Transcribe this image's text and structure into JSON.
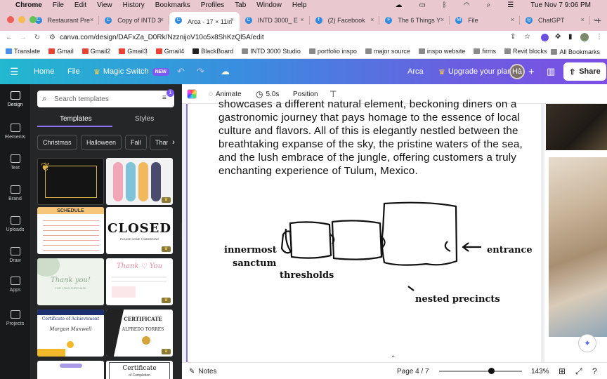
{
  "menubar": {
    "app": "Chrome",
    "items": [
      "File",
      "Edit",
      "View",
      "History",
      "Bookmarks",
      "Profiles",
      "Tab",
      "Window",
      "Help"
    ],
    "datetime": "Tue Nov 7  9:06 PM"
  },
  "tabs": [
    {
      "title": "Restaurant Pre",
      "fav": "C",
      "active": false
    },
    {
      "title": "Copy of INTD 3",
      "fav": "C",
      "active": false
    },
    {
      "title": "Arca - 17 × 11in",
      "fav": "C",
      "active": true
    },
    {
      "title": "INTD 3000_ E",
      "fav": "C",
      "active": false
    },
    {
      "title": "(2) Facebook",
      "fav": "f",
      "active": false
    },
    {
      "title": "The 6 Things Y",
      "fav": "F",
      "active": false
    },
    {
      "title": "File",
      "fav": "M",
      "active": false
    },
    {
      "title": "ChatGPT",
      "fav": "◎",
      "active": false
    }
  ],
  "address": {
    "url": "canva.com/design/DAFxZa_D0Rk/NzznijoV10o5x8ShKzQl5A/edit"
  },
  "bookmarks": [
    "Translate",
    "Gmail",
    "Gmail2",
    "Gmail3",
    "Gmail4",
    "BlackBoard",
    "INTD 3000 Studio",
    "portfolio inspo",
    "major source",
    "inspo website",
    "firms",
    "Revit blocks"
  ],
  "bookmarks_all": "All Bookmarks",
  "toolbar": {
    "home": "Home",
    "file": "File",
    "magic": "Magic Switch",
    "new_badge": "NEW",
    "design_name": "Arca",
    "upgrade": "Upgrade your plan",
    "avatar": "Hà",
    "share": "Share"
  },
  "rail": [
    {
      "label": "Design",
      "icon": "design-icon",
      "active": true
    },
    {
      "label": "Elements",
      "icon": "elements-icon",
      "active": false
    },
    {
      "label": "Text",
      "icon": "text-icon",
      "active": false
    },
    {
      "label": "Brand",
      "icon": "brand-icon",
      "active": false
    },
    {
      "label": "Uploads",
      "icon": "cloud-upload-icon",
      "active": false
    },
    {
      "label": "Draw",
      "icon": "pen-icon",
      "active": false
    },
    {
      "label": "Apps",
      "icon": "apps-grid-icon",
      "active": false
    },
    {
      "label": "Projects",
      "icon": "folder-icon",
      "active": false
    }
  ],
  "panel": {
    "search_placeholder": "Search templates",
    "filter_badge": "1",
    "tabs": [
      "Templates",
      "Styles"
    ],
    "chips": [
      "Christmas",
      "Halloween",
      "Fall",
      "Thank"
    ],
    "templates": [
      {
        "name": "gold-frame-template",
        "kind": "frame"
      },
      {
        "name": "bookmarks-template",
        "kind": "bookmarks"
      },
      {
        "name": "schedule-template",
        "title": "SCHEDULE",
        "kind": "schedule"
      },
      {
        "name": "closed-sign-template",
        "title": "CLOSED",
        "sub": "PLEASE COME TOMORROW!",
        "kind": "closed"
      },
      {
        "name": "thank-you-green-template",
        "title": "Thank you!",
        "sub": "FOR YOUR PURCHASE",
        "kind": "thanks1"
      },
      {
        "name": "thank-you-pink-template",
        "title": "Thank ♡ You",
        "kind": "thanks2"
      },
      {
        "name": "certificate-achievement-template",
        "title": "Certificate of Achievement",
        "sub": "Morgan Maxwell",
        "kind": "cert1"
      },
      {
        "name": "certificate-gold-template",
        "title": "CERTIFICATE",
        "sub": "ALFREDO TORRES",
        "kind": "cert2"
      },
      {
        "name": "mindmap-template",
        "kind": "mindmap"
      },
      {
        "name": "certificate-completion-template",
        "title": "Certificate",
        "sub": "of Completion",
        "kind": "cert3"
      }
    ]
  },
  "context": {
    "animate": "Animate",
    "duration": "5.0s",
    "position": "Position"
  },
  "canvas": {
    "paragraph": "showcases a different natural element, beckoning diners on a gastronomic journey that pays homage to the essence of local culture and flavors. All of this is elegantly nestled between the breathtaking expanse of the sky, the pristine waters of the sea, and the lush embrace of the jungle, offering customers a truly enchanting experience of Tulum, Mexico.",
    "diagram_labels": {
      "innermost": "innermost",
      "sanctum": "sanctum",
      "thresholds": "thresholds",
      "entrance": "entrance",
      "nested": "nested precincts"
    }
  },
  "bottom": {
    "notes": "Notes",
    "page": "Page 4 / 7",
    "zoom": "143%",
    "zoom_level": 0.63
  }
}
